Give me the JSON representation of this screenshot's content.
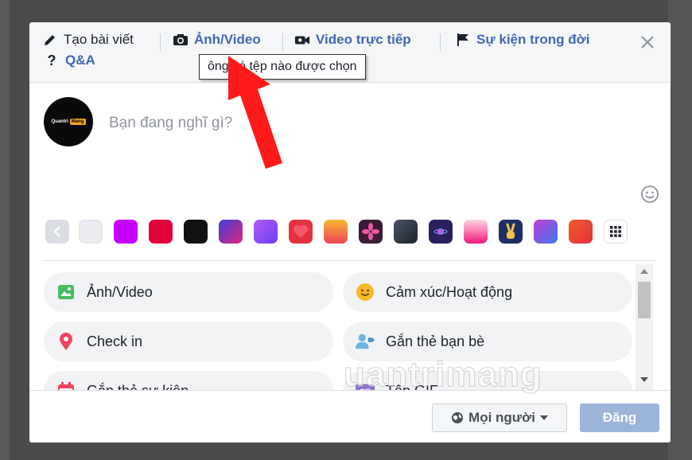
{
  "tabs": {
    "create_post": "Tạo bài viết",
    "photo_video": "Ảnh/Video",
    "live_video": "Video trực tiếp",
    "life_event": "Sự kiện trong đời",
    "qa": "Q&A"
  },
  "tooltip": "ông có tệp nào được chọn",
  "avatar": {
    "brand": "Quantri",
    "tag": "Mang"
  },
  "composer": {
    "placeholder": "Bạn đang nghĩ gì?"
  },
  "swatches": {
    "colors": [
      "#ebedf0",
      "#c600ff",
      "#e2013b",
      "#111111",
      "#5f2ad8",
      "#8a4df2",
      "#e3323f",
      "#f49a2b",
      "#3b1c34",
      "#2f3a4a",
      "#2b1f5c",
      "#f0197d",
      "#1f2f66",
      "#c63bd4",
      "#e5313d"
    ]
  },
  "actions": [
    {
      "label": "Ảnh/Video",
      "icon": "photo-icon"
    },
    {
      "label": "Cảm xúc/Hoạt động",
      "icon": "smiley-icon"
    },
    {
      "label": "Check in",
      "icon": "location-pin-icon"
    },
    {
      "label": "Gắn thẻ bạn bè",
      "icon": "tag-friends-icon"
    },
    {
      "label": "Gắn thẻ sự kiện",
      "icon": "calendar-icon"
    },
    {
      "label": "Tệp GIF",
      "icon": "gif-icon"
    }
  ],
  "footer": {
    "privacy": "Mọi người",
    "post": "Đăng"
  },
  "watermark": "uantrimang",
  "colors": {
    "accent": "#4267b2",
    "post_disabled": "#9cb4d8",
    "arrow": "#ff1a1a"
  }
}
